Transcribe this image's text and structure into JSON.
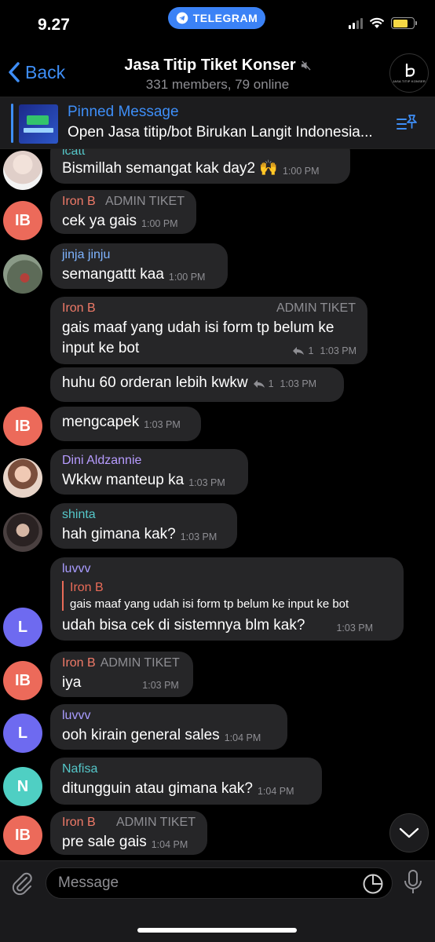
{
  "status_bar": {
    "time": "9.27",
    "app_pill": "TELEGRAM"
  },
  "header": {
    "back_label": "Back",
    "title": "Jasa Titip Tiket Konser",
    "subtitle": "331 members, 79 online",
    "avatar_caption": "JASA TITIP KONSER"
  },
  "pinned": {
    "title": "Pinned Message",
    "text": "Open Jasa titip/bot Birukan Langit Indonesia..."
  },
  "messages": [
    {
      "sender": "lcatt",
      "badge": "",
      "text": "Bismillah semangat kak day2 🙌",
      "time": "1:00 PM",
      "name_color": "#55c7c9",
      "avatar": "",
      "avatar_color": "#e9dfe0"
    },
    {
      "sender": "Iron B",
      "badge": "ADMIN TIKET",
      "text": "cek ya gais",
      "time": "1:00 PM",
      "name_color": "#ef7a68",
      "avatar": "IB",
      "avatar_color": "#ec6a5a"
    },
    {
      "sender": "jinja jinju",
      "badge": "",
      "text": "semangattt kaa",
      "time": "1:00 PM",
      "name_color": "#7fb4ff",
      "avatar": "",
      "avatar_color": "#5a6a5a"
    },
    {
      "sender": "Iron B",
      "badge": "ADMIN TIKET",
      "text": "gais maaf yang udah isi form tp belum ke input ke bot",
      "time": "1:03 PM",
      "replies": "1",
      "name_color": "#ef7a68"
    },
    {
      "sender": "",
      "badge": "",
      "text": "huhu 60 orderan lebih kwkw",
      "time": "1:03 PM",
      "replies": "1"
    },
    {
      "sender": "",
      "badge": "",
      "text": "mengcapek",
      "time": "1:03 PM",
      "avatar": "IB",
      "avatar_color": "#ec6a5a"
    },
    {
      "sender": "Dini Aldzannie",
      "badge": "",
      "text": "Wkkw manteup ka",
      "time": "1:03 PM",
      "name_color": "#b79cff",
      "avatar": "",
      "avatar_color": "#d8b8a8"
    },
    {
      "sender": "shinta",
      "badge": "",
      "text": "hah gimana kak?",
      "time": "1:03 PM",
      "name_color": "#55c7c9",
      "avatar": "",
      "avatar_color": "#3a3434"
    },
    {
      "sender": "luvvv",
      "badge": "",
      "reply_name": "Iron B",
      "reply_text": "gais maaf yang udah isi form tp belum ke input ke bot",
      "text": "udah bisa cek di sistemnya blm kak?",
      "time": "1:03 PM",
      "name_color": "#a99cff",
      "avatar": "L",
      "avatar_color": "#6e6af0"
    },
    {
      "sender": "Iron B",
      "badge": "ADMIN TIKET",
      "text": "iya",
      "time": "1:03 PM",
      "name_color": "#ef7a68",
      "avatar": "IB",
      "avatar_color": "#ec6a5a"
    },
    {
      "sender": "luvvv",
      "badge": "",
      "text": "ooh kirain general sales",
      "time": "1:04 PM",
      "name_color": "#a99cff",
      "avatar": "L",
      "avatar_color": "#6e6af0"
    },
    {
      "sender": "Nafisa",
      "badge": "",
      "text": "ditungguin atau gimana kak?",
      "time": "1:04 PM",
      "name_color": "#55c7c9",
      "avatar": "N",
      "avatar_color": "#4fcfc3"
    },
    {
      "sender": "Iron B",
      "badge": "ADMIN TIKET",
      "text": "pre sale gais",
      "time": "1:04 PM",
      "name_color": "#ef7a68",
      "avatar": "IB",
      "avatar_color": "#ec6a5a"
    }
  ],
  "input": {
    "placeholder": "Message"
  }
}
